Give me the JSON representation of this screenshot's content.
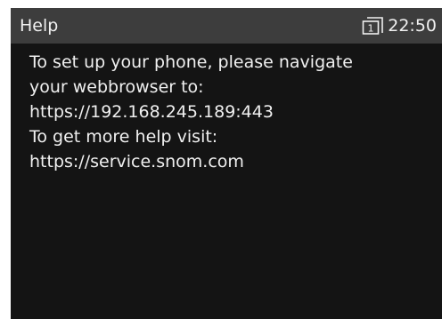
{
  "header": {
    "title": "Help",
    "line_indicator": "1",
    "time": "22:50"
  },
  "content": {
    "lines": [
      "To set up your phone, please navigate",
      "your webbrowser to:",
      "https://192.168.245.189:443",
      "To get more help visit:",
      "https://service.snom.com"
    ]
  },
  "colors": {
    "screen_bg": "#141414",
    "status_bar_bg": "#3d3d3d",
    "text": "#f0f0f0"
  }
}
